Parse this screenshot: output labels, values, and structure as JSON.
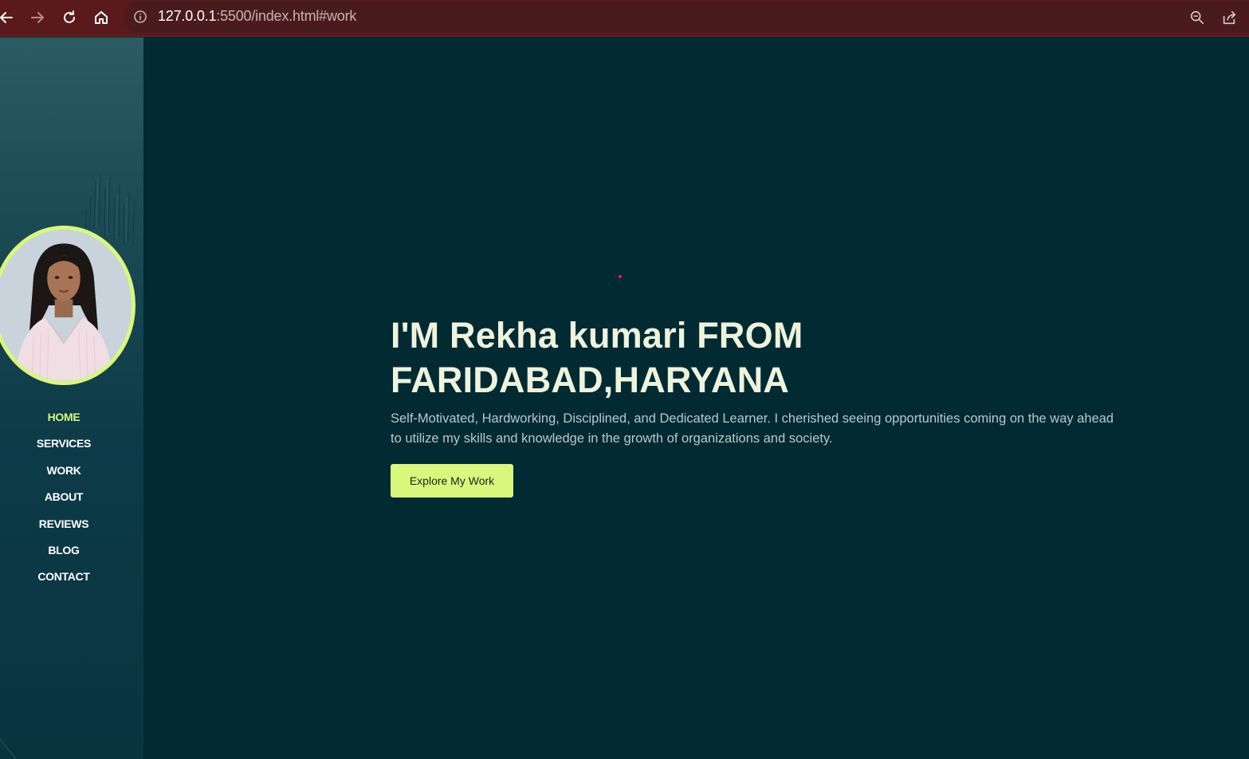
{
  "browser": {
    "url_host": "127.0.0.1",
    "url_rest": ":5500/index.html#work",
    "icons": [
      "back-icon",
      "forward-icon",
      "reload-icon",
      "home-icon",
      "info-icon",
      "zoom-icon",
      "share-icon"
    ]
  },
  "sidebar": {
    "items": [
      {
        "label": "HOME",
        "active": true
      },
      {
        "label": "SERVICES",
        "active": false
      },
      {
        "label": "WORK",
        "active": false
      },
      {
        "label": "ABOUT",
        "active": false
      },
      {
        "label": "REVIEWS",
        "active": false
      },
      {
        "label": "BLOG",
        "active": false
      },
      {
        "label": "CONTACT",
        "active": false
      }
    ]
  },
  "hero": {
    "title_line1": "I'M Rekha kumari FROM",
    "title_line2": "FARIDABAD,HARYANA",
    "description": "Self-Motivated, Hardworking, Disciplined, and Dedicated Learner. I cherished seeing opportunities coming on the way ahead to utilize my skills and knowledge in the growth of organizations and society.",
    "cta_label": "Explore My Work"
  },
  "colors": {
    "browser_bar": "#5a1a1c",
    "main_bg": "#022a33",
    "accent": "#d9f77a",
    "title_text": "#eef3dc",
    "body_text": "#b8c8c9"
  }
}
